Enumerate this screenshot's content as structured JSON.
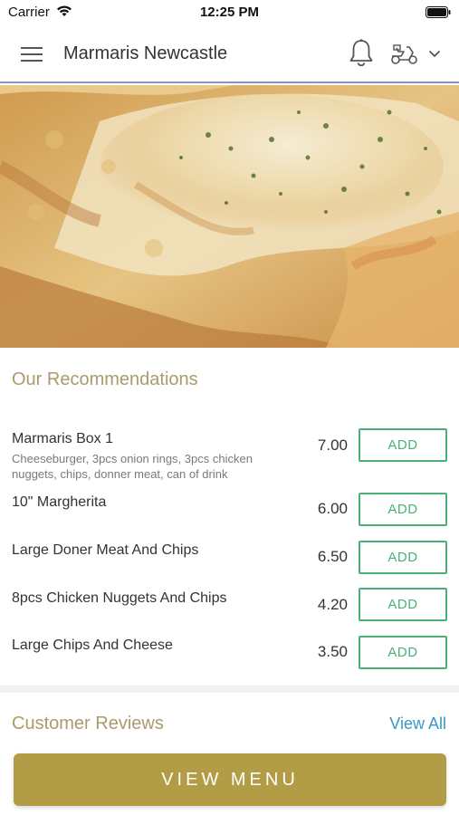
{
  "status_bar": {
    "carrier": "Carrier",
    "time": "12:25 PM"
  },
  "header": {
    "title": "Marmaris Newcastle"
  },
  "recommendations": {
    "title": "Our Recommendations",
    "items": [
      {
        "name": "Marmaris Box 1",
        "description": "Cheeseburger, 3pcs onion rings, 3pcs chicken nuggets, chips, donner meat, can of drink",
        "price": "7.00",
        "button": "ADD"
      },
      {
        "name": "10\" Margherita",
        "price": "6.00",
        "button": "ADD"
      },
      {
        "name": "Large Doner Meat And Chips",
        "price": "6.50",
        "button": "ADD"
      },
      {
        "name": "8pcs Chicken Nuggets And Chips",
        "price": "4.20",
        "button": "ADD"
      },
      {
        "name": "Large Chips And Cheese",
        "price": "3.50",
        "button": "ADD"
      }
    ]
  },
  "reviews": {
    "title": "Customer Reviews",
    "view_all": "View All"
  },
  "footer": {
    "view_menu": "VIEW MENU"
  },
  "colors": {
    "accent_gold": "#b29d46",
    "add_green": "#4caf7a",
    "link_blue": "#3a97c9",
    "section_title": "#a99b6c"
  }
}
